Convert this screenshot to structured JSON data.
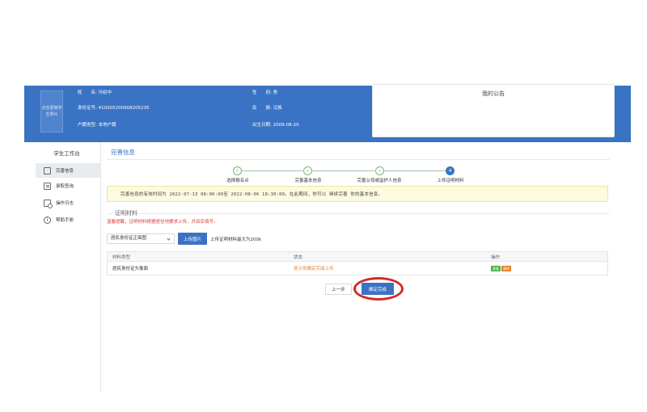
{
  "header": {
    "photo_text": "点击更换学生照片",
    "fields": [
      {
        "label": "姓　　名:",
        "value": "冯初中"
      },
      {
        "label": "身份证号:",
        "value": "410305200908205235"
      },
      {
        "label": "户籍类型:",
        "value": "本地户籍"
      },
      {
        "label": "性　　别:",
        "value": "男"
      },
      {
        "label": "民　　族:",
        "value": "汉族"
      },
      {
        "label": "出生日期:",
        "value": "2009-08-20"
      }
    ],
    "notice_title": "我的公告"
  },
  "sidebar": {
    "title": "学生工作台",
    "items": [
      {
        "label": "完善信息",
        "icon": "id-card-icon"
      },
      {
        "label": "录取查询",
        "icon": "document-icon"
      },
      {
        "label": "操作日志",
        "icon": "log-icon"
      },
      {
        "label": "帮助手册",
        "icon": "info-icon"
      }
    ]
  },
  "main": {
    "title": "完善信息",
    "steps": [
      {
        "label": "选择报名点",
        "marker": "✓"
      },
      {
        "label": "完善基本信息",
        "marker": "✓"
      },
      {
        "label": "完善父母或监护人信息",
        "marker": "✓"
      },
      {
        "label": "上传证明材料",
        "marker": "4"
      }
    ],
    "alert": "完善信息的有效时间为 2022-07-13 08:00:00至 2022-08-06 18:30:00。在此期间，你可以 继续完善 你的基本信息。",
    "section_title": "证明材料",
    "warning": "温馨提醒，证明材料根据居住地要求上传，并如实填写。",
    "upload": {
      "select_value": "居民身份证正面图",
      "button_label": "上传图片",
      "hint": "上传证明材料最大为200k"
    },
    "table": {
      "headers": [
        "材料类型",
        "状态",
        "操作"
      ],
      "rows": [
        {
          "type": "居民身份证头像面",
          "status": "提示你确定完成上传",
          "view": "查看",
          "delete": "删除"
        }
      ]
    },
    "prev_label": "上一步",
    "confirm_label": "确定完成"
  },
  "colors": {
    "primary": "#3a73c4",
    "alert_bg": "#fdfae0",
    "warning": "#e04040",
    "status": "#e38533",
    "highlight": "#d62828"
  }
}
